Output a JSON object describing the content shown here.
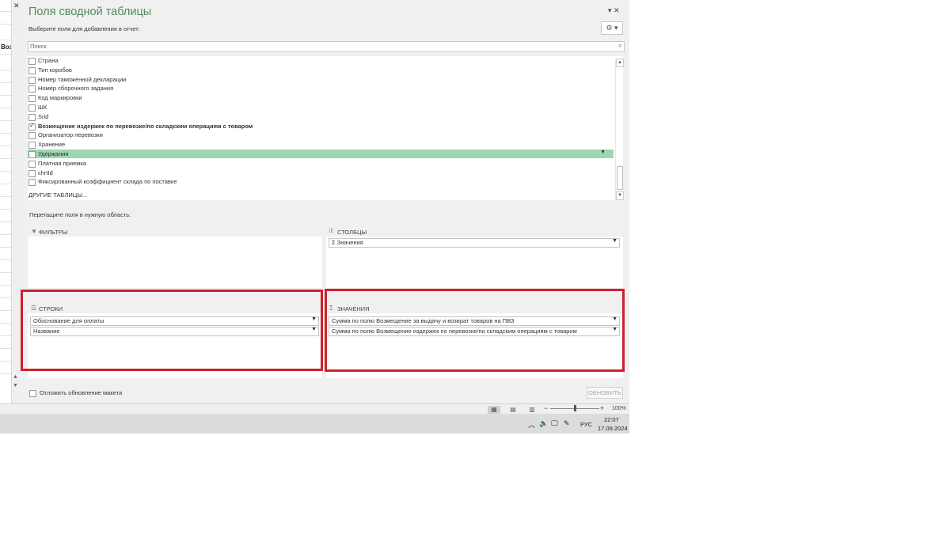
{
  "left_sheet": {
    "cell_text": "Воз",
    "close_glyph": "✕"
  },
  "pane": {
    "title": "Поля сводной таблицы",
    "top_icons": "▾  ✕",
    "choose_label": "Выберите поля для добавления в отчет:",
    "gear_label": "⚙ ▾",
    "search_placeholder": "Поиск",
    "search_icon": "⌕",
    "fields": [
      {
        "label": "Страна",
        "checked": false,
        "bold": false,
        "selected": false
      },
      {
        "label": "Тип коробов",
        "checked": false,
        "bold": false,
        "selected": false
      },
      {
        "label": "Номер таможенной декларации",
        "checked": false,
        "bold": false,
        "selected": false
      },
      {
        "label": "Номер сборочного задания",
        "checked": false,
        "bold": false,
        "selected": false
      },
      {
        "label": "Код маркировки",
        "checked": false,
        "bold": false,
        "selected": false
      },
      {
        "label": "ШК",
        "checked": false,
        "bold": false,
        "selected": false
      },
      {
        "label": "Srid",
        "checked": false,
        "bold": false,
        "selected": false
      },
      {
        "label": "Возмещение издержек по перевозке/по складским операциям с товаром",
        "checked": true,
        "bold": true,
        "selected": false
      },
      {
        "label": "Организатор перевозки",
        "checked": false,
        "bold": false,
        "selected": false
      },
      {
        "label": "Хранение",
        "checked": false,
        "bold": false,
        "selected": false
      },
      {
        "label": "Удержания",
        "checked": false,
        "bold": false,
        "selected": true
      },
      {
        "label": "Платная приемка",
        "checked": false,
        "bold": false,
        "selected": false
      },
      {
        "label": "chrtId",
        "checked": false,
        "bold": false,
        "selected": false
      },
      {
        "label": "Фиксированный коэффициент склада по поставке",
        "checked": false,
        "bold": false,
        "selected": false
      }
    ],
    "other_tables": "ДРУГИЕ ТАБЛИЦЫ...",
    "drag_label": "Перетащите поля в нужную область:",
    "areas": {
      "filters": {
        "title": "ФИЛЬТРЫ",
        "icon": "▼"
      },
      "columns": {
        "title": "СТОЛБЦЫ",
        "icon": "|||",
        "items": [
          "Σ  Значения"
        ]
      },
      "rows": {
        "title": "СТРОКИ",
        "icon": "☰",
        "items": [
          "Обоснование для оплаты",
          "Название"
        ]
      },
      "values": {
        "title": "ЗНАЧЕНИЯ",
        "icon": "Σ",
        "items": [
          "Сумма по полю Возмещение за выдачу и возврат товаров на ПВЗ",
          "Сумма по полю Возмещение издержек по перевозке/по складским операциям с товаром"
        ]
      }
    },
    "defer_label": "Отложить обновление макета",
    "update_button": "ОБНОВИТЬ"
  },
  "statusbar": {
    "zoom_minus": "−",
    "zoom_plus": "+",
    "zoom": "100%",
    "zoom_fraction": 0.5
  },
  "taskbar": {
    "language": "РУС",
    "time": "22:07",
    "date": "17.09.2024"
  },
  "colors": {
    "accent": "#4e8a5f",
    "selected_field": "#9dd6b3",
    "highlight_frame": "#d0202c"
  }
}
